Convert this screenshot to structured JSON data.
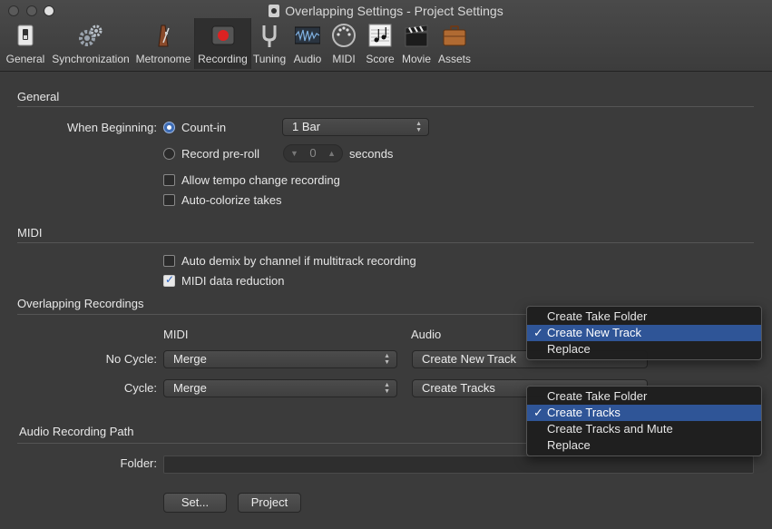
{
  "window": {
    "title": "Overlapping Settings - Project Settings"
  },
  "toolbar": [
    {
      "label": "General",
      "icon": "general-switch-icon"
    },
    {
      "label": "Synchronization",
      "icon": "gears-icon"
    },
    {
      "label": "Metronome",
      "icon": "metronome-icon"
    },
    {
      "label": "Recording",
      "icon": "record-icon",
      "selected": true
    },
    {
      "label": "Tuning",
      "icon": "tuning-fork-icon"
    },
    {
      "label": "Audio",
      "icon": "audio-waveform-icon"
    },
    {
      "label": "MIDI",
      "icon": "midi-connector-icon"
    },
    {
      "label": "Score",
      "icon": "score-notes-icon"
    },
    {
      "label": "Movie",
      "icon": "clapperboard-icon"
    },
    {
      "label": "Assets",
      "icon": "briefcase-icon"
    }
  ],
  "general": {
    "title": "General",
    "when_beginning_label": "When Beginning:",
    "count_in_label": "Count-in",
    "count_in_value": "1 Bar",
    "record_preroll_label": "Record pre-roll",
    "preroll_value": "0",
    "seconds_label": "seconds",
    "allow_tempo_label": "Allow tempo change recording",
    "auto_colorize_label": "Auto-colorize takes"
  },
  "midi": {
    "title": "MIDI",
    "auto_demix_label": "Auto demix by channel if multitrack recording",
    "data_reduction_label": "MIDI data reduction"
  },
  "overlapping": {
    "title": "Overlapping Recordings",
    "midi_col": "MIDI",
    "audio_col": "Audio",
    "no_cycle_label": "No Cycle:",
    "cycle_label": "Cycle:",
    "no_cycle_midi": "Merge",
    "no_cycle_audio": "Create New Track",
    "cycle_midi": "Merge",
    "cycle_audio": "Create Tracks"
  },
  "path": {
    "title": "Audio Recording Path",
    "folder_label": "Folder:",
    "set_button": "Set...",
    "project_button": "Project"
  },
  "menu_no_cycle": {
    "items": [
      "Create Take Folder",
      "Create New Track",
      "Replace"
    ],
    "selected_index": 1,
    "check": "✓"
  },
  "menu_cycle": {
    "items": [
      "Create Take Folder",
      "Create Tracks",
      "Create Tracks and Mute",
      "Replace"
    ],
    "selected_index": 1,
    "check": "✓"
  }
}
